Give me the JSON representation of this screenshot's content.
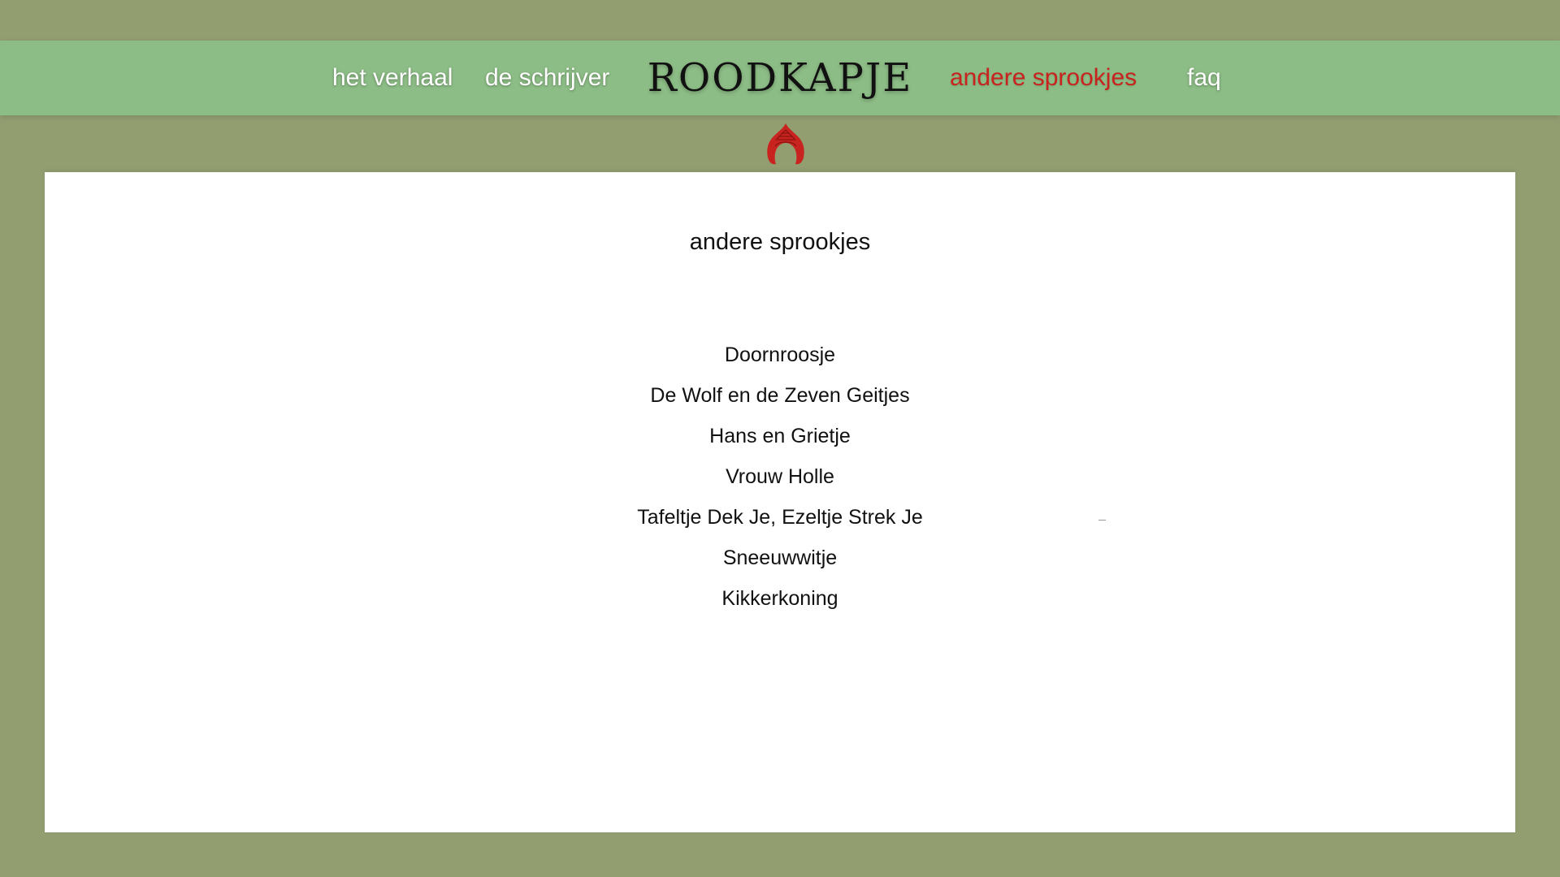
{
  "nav": {
    "items": [
      {
        "label": "het verhaal",
        "active": false
      },
      {
        "label": "de schrijver",
        "active": false
      },
      {
        "label": "andere sprookjes",
        "active": true
      },
      {
        "label": "faq",
        "active": false
      }
    ],
    "brand": "ROODKAPJE"
  },
  "logo": {
    "icon": "red-hood-icon",
    "color": "#c8231e"
  },
  "main": {
    "title": "andere sprookjes",
    "tales": [
      "Doornroosje",
      "De Wolf en de Zeven Geitjes",
      "Hans en Grietje",
      "Vrouw Holle",
      "Tafeltje Dek Je, Ezeltje Strek Je",
      "Sneeuwwitje",
      "Kikkerkoning"
    ]
  },
  "colors": {
    "background": "#929d70",
    "nav_bar": "#8dbd86",
    "active_link": "#c8231e",
    "panel": "#ffffff"
  }
}
